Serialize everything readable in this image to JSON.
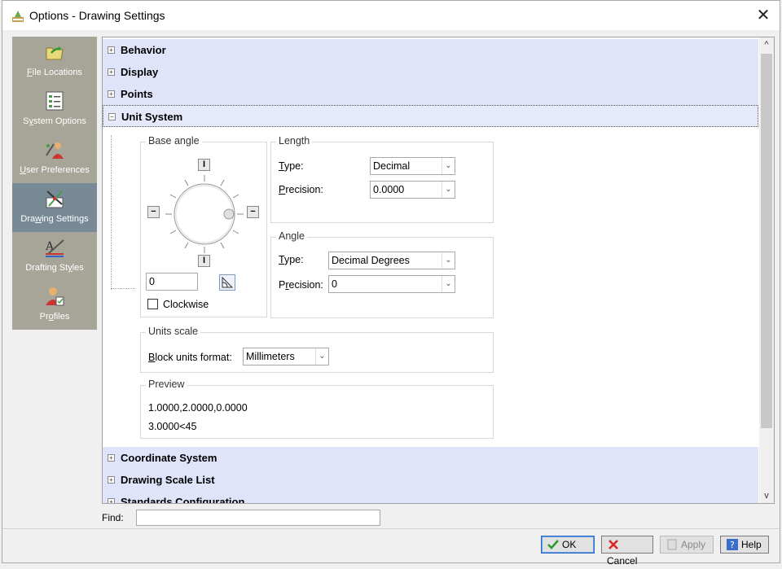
{
  "window": {
    "title": "Options - Drawing Settings",
    "close": "✕"
  },
  "nav": [
    {
      "prefix": "",
      "hot": "F",
      "rest": "ile Locations",
      "selected": false
    },
    {
      "prefix": "S",
      "hot": "y",
      "rest": "stem Options",
      "selected": false
    },
    {
      "prefix": "",
      "hot": "U",
      "rest": "ser Preferences",
      "selected": false
    },
    {
      "prefix": "Dra",
      "hot": "w",
      "rest": "ing Settings",
      "selected": true
    },
    {
      "prefix": "Drafting St",
      "hot": "y",
      "rest": "les",
      "selected": false
    },
    {
      "prefix": "Pr",
      "hot": "o",
      "rest": "files",
      "selected": false
    }
  ],
  "categories": {
    "behavior": "Behavior",
    "display": "Display",
    "points": "Points",
    "unit_system": "Unit System",
    "coordinate_system": "Coordinate System",
    "drawing_scale_list": "Drawing Scale List",
    "standards_configuration": "Standards Configuration"
  },
  "expand_glyph": {
    "collapsed": "+",
    "expanded": "−"
  },
  "base_angle": {
    "title": "Base angle",
    "value": "0",
    "clockwise": "Clockwise",
    "top_btn": "I",
    "bottom_btn": "I",
    "left_btn": "−",
    "right_btn": "−"
  },
  "length": {
    "title": "Length",
    "type_hot": "T",
    "type_rest": "ype:",
    "type_value": "Decimal",
    "precision_hot": "P",
    "precision_rest": "recision:",
    "precision_value": "0.0000"
  },
  "angle": {
    "title": "Angle",
    "type_hot": "T",
    "type_rest": "ype:",
    "type_value": "Decimal Degrees",
    "precision_prefix": "P",
    "precision_hot": "r",
    "precision_rest": "ecision:",
    "precision_value": "0"
  },
  "units_scale": {
    "title": "Units scale",
    "label_hot": "B",
    "label_rest": "lock units format:",
    "value": "Millimeters"
  },
  "preview": {
    "title": "Preview",
    "line1": "1.0000,2.0000,0.0000",
    "line2": "3.0000<45"
  },
  "find": {
    "label": "Find:",
    "value": ""
  },
  "buttons": {
    "ok": "OK",
    "cancel": "Cancel",
    "apply": "Apply",
    "help": "Help"
  },
  "scroll": {
    "up": "^",
    "down": "v"
  },
  "colors": {
    "nav_bg": "#a7a498",
    "nav_selected": "#778a96",
    "category_bg": "#e0e4fb"
  }
}
